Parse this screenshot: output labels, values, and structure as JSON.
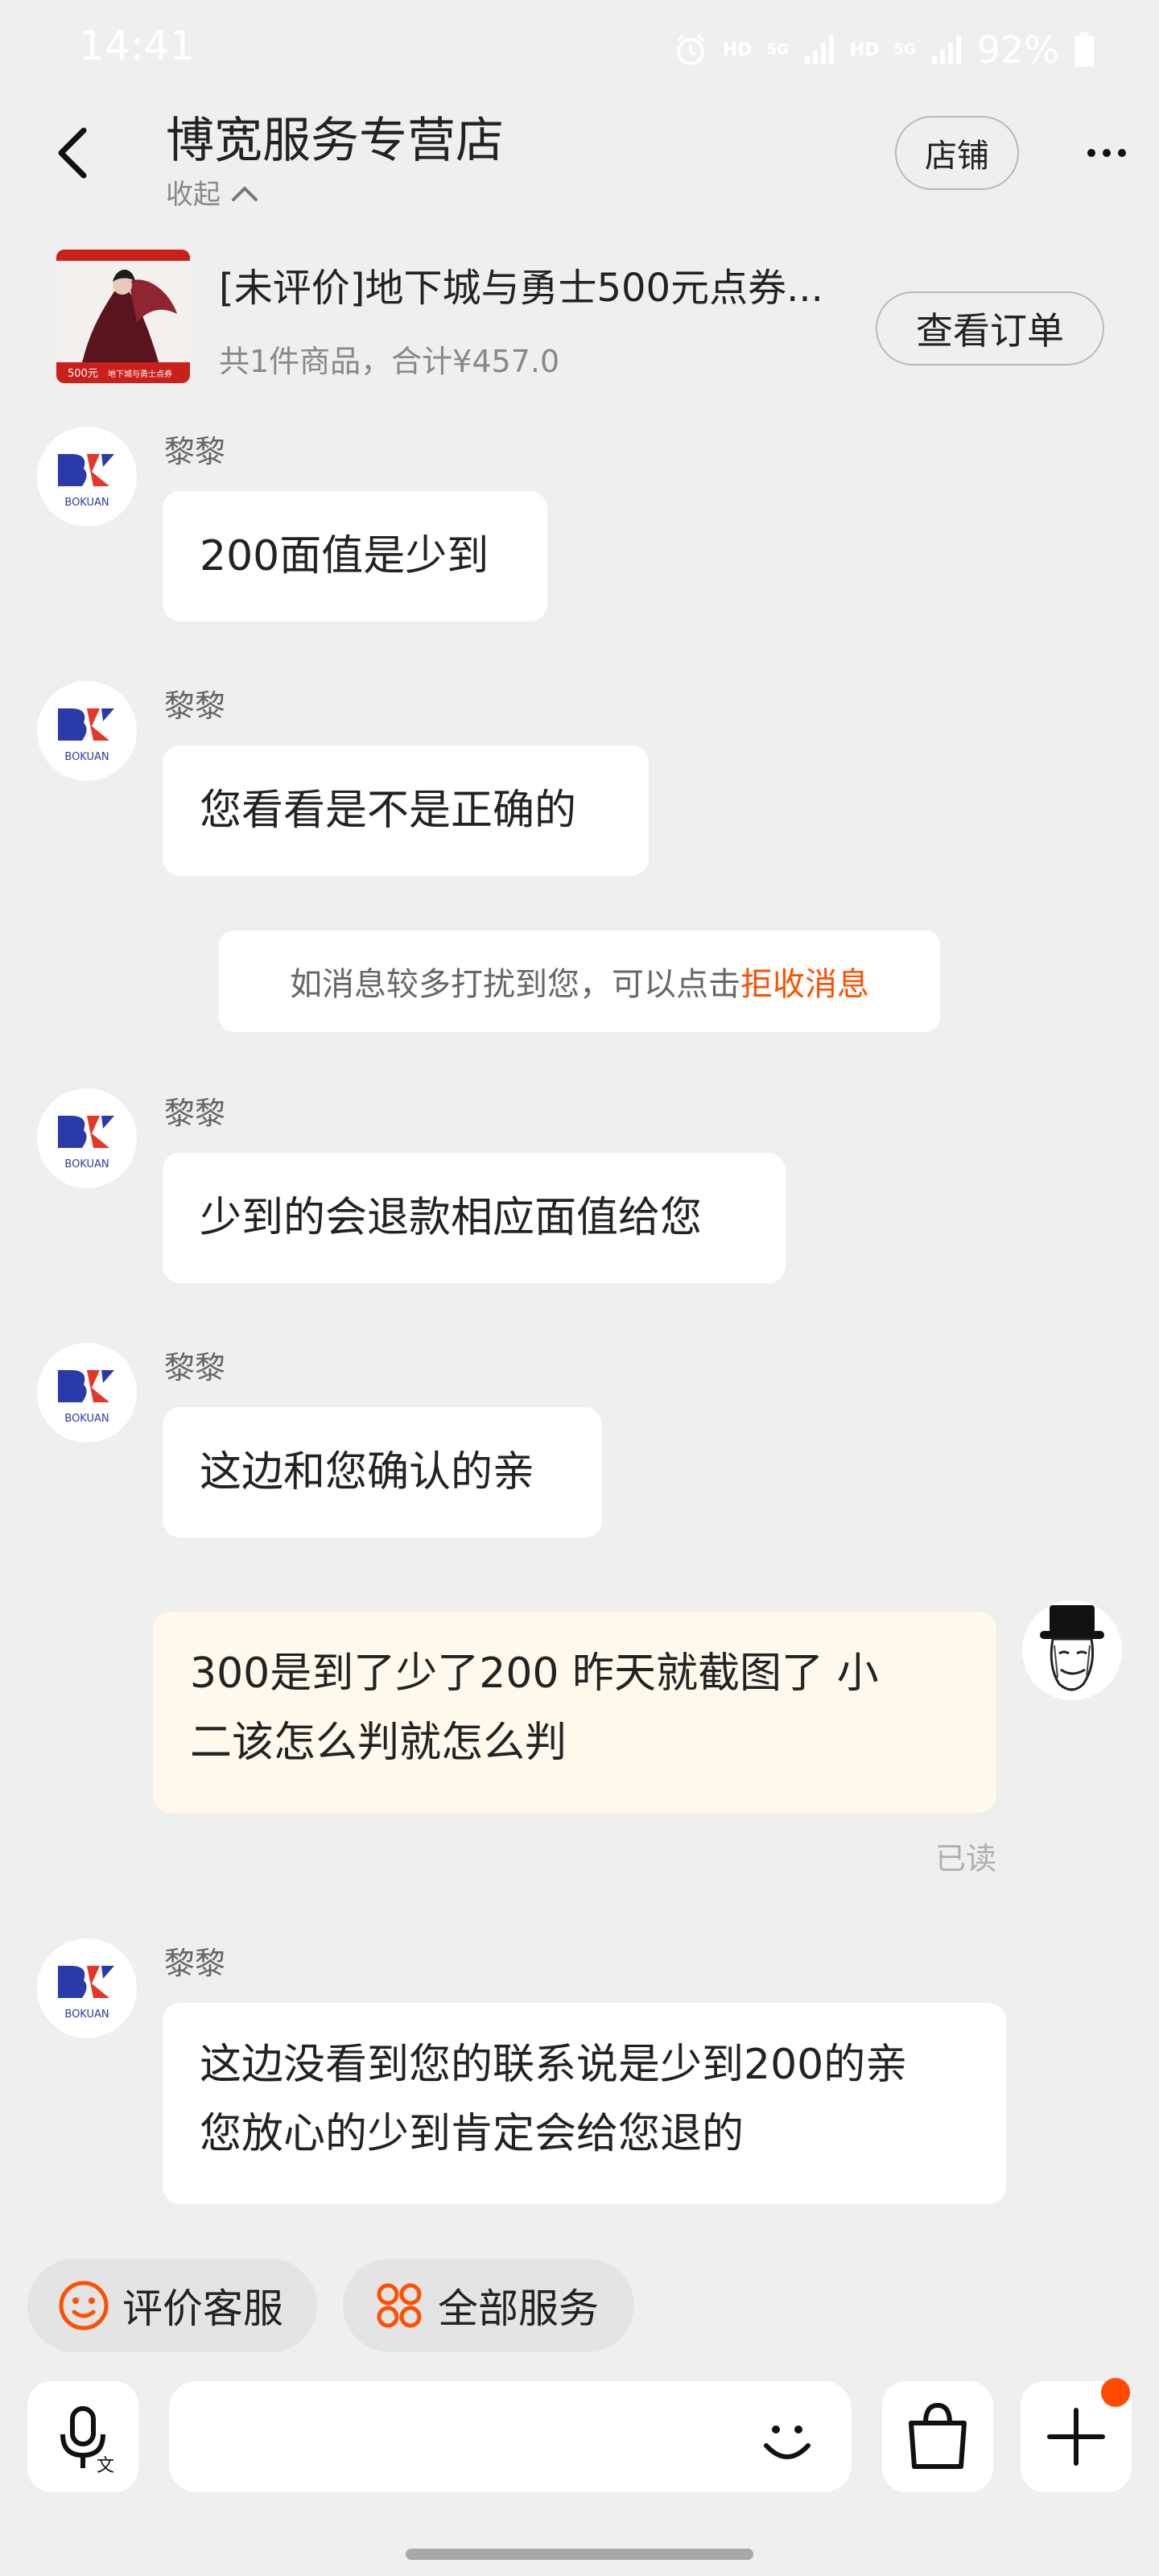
{
  "status_bar": {
    "time": "14:41",
    "hd1": "HD",
    "g5a": "5G",
    "hd2": "HD",
    "g5b": "5G",
    "battery": "92%"
  },
  "header": {
    "shop_name": "博宽服务专营店",
    "collapse_label": "收起",
    "store_button": "店铺"
  },
  "order": {
    "title": "[未评价]地下城与勇士500元点券...",
    "summary": "共1件商品，合计¥457.0",
    "view_button": "查看订单",
    "thumb_price": "500元",
    "thumb_caption": "地下城与勇士点券"
  },
  "brand": {
    "avatar_text": "BOKUAN"
  },
  "messages": [
    {
      "sender": "黎黎",
      "text": "200面值是少到"
    },
    {
      "sender": "黎黎",
      "text": "您看看是不是正确的"
    },
    {
      "sender": "黎黎",
      "text": "少到的会退款相应面值给您"
    },
    {
      "sender": "黎黎",
      "text": "这边和您确认的亲"
    },
    {
      "sender": "me",
      "line1": "300是到了少了200 昨天就截图了 小",
      "line2": "二该怎么判就怎么判",
      "status": "已读"
    },
    {
      "sender": "黎黎",
      "line1": "这边没看到您的联系说是少到200的亲",
      "line2": "您放心的少到肯定会给您退的"
    }
  ],
  "system_notice": {
    "text": "如消息较多打扰到您，可以点击 ",
    "link": "拒收消息"
  },
  "quick_actions": {
    "rate": "评价客服",
    "all_services": "全部服务"
  },
  "colors": {
    "accent": "#ff5000",
    "brand_blue": "#2a3aa8",
    "brand_red": "#e5362a",
    "my_bubble": "#fff8ec"
  }
}
